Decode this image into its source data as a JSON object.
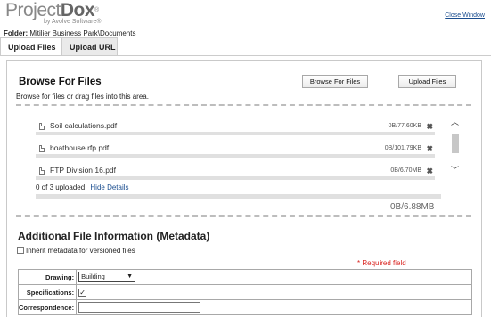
{
  "header": {
    "logo_main_a": "Project",
    "logo_main_b": "Dox",
    "logo_trademark": "®",
    "logo_sub": "by Avolve Software®",
    "close_window": "Close Window"
  },
  "folder": {
    "label": "Folder:",
    "path": " Mitilier Business Park\\Documents"
  },
  "tabs": [
    {
      "label": "Upload Files",
      "active": true
    },
    {
      "label": "Upload URL",
      "active": false
    }
  ],
  "browse": {
    "title": "Browse For Files",
    "description": "Browse for files or drag files into this area.",
    "browse_button": "Browse For Files",
    "upload_button": "Upload Files"
  },
  "files": [
    {
      "name": "Soil calculations.pdf",
      "size": "0B/77.60KB",
      "progress": 0
    },
    {
      "name": "boathouse rfp.pdf",
      "size": "0B/101.79KB",
      "progress": 0
    },
    {
      "name": "FTP Division 16.pdf",
      "size": "0B/6.70MB",
      "progress": 0
    }
  ],
  "upload_status": {
    "text": "0 of 3 uploaded",
    "hide_details": "Hide Details",
    "total": "0B/6.88MB",
    "progress": 0
  },
  "metadata": {
    "title": "Additional File Information (Metadata)",
    "inherit_label": "Inherit metadata for versioned files",
    "inherit_checked": false,
    "required_note": "* Required field",
    "fields": {
      "drawing_label": "Drawing:",
      "drawing_value": "Building",
      "specifications_label": "Specifications:",
      "specifications_checked": true,
      "correspondence_label": "Correspondence:",
      "correspondence_value": ""
    }
  },
  "icons": {
    "file": "pdf-file-icon",
    "remove": "remove-x-icon",
    "scroll_up": "chevron-up-icon",
    "scroll_down": "chevron-down-icon"
  },
  "colors": {
    "link": "#1a4d8f",
    "required": "#d9231f",
    "progress_track": "#e0e0e0"
  }
}
